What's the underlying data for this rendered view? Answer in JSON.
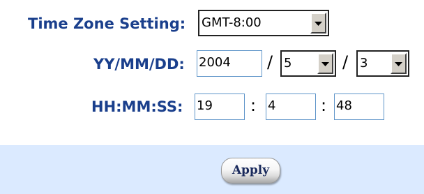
{
  "time_zone": {
    "label": "Time Zone Setting:",
    "selected": "GMT-8:00"
  },
  "date": {
    "label": "YY/MM/DD:",
    "year": "2004",
    "separator": "/",
    "month": "5",
    "day": "3"
  },
  "time": {
    "label": "HH:MM:SS:",
    "hour": "19",
    "minute": "4",
    "second": "48",
    "separator": ":"
  },
  "apply_label": "Apply",
  "colors": {
    "label_text": "#1a3f8c",
    "footer_band": "#dbeaff",
    "input_border": "#5f95c9"
  },
  "icons": {
    "dropdown": "chevron-down-icon"
  }
}
